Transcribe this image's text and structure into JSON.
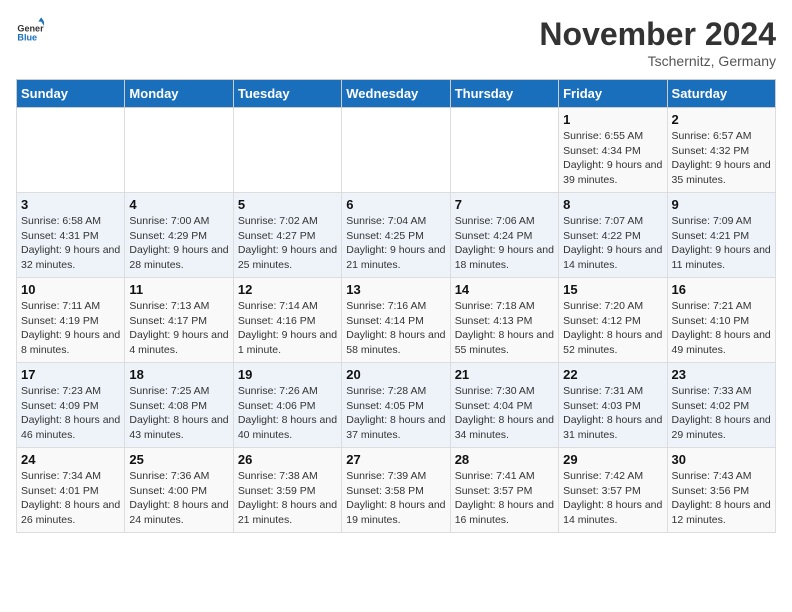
{
  "logo": {
    "general": "General",
    "blue": "Blue"
  },
  "header": {
    "month": "November 2024",
    "location": "Tschernitz, Germany"
  },
  "weekdays": [
    "Sunday",
    "Monday",
    "Tuesday",
    "Wednesday",
    "Thursday",
    "Friday",
    "Saturday"
  ],
  "weeks": [
    [
      {
        "day": "",
        "info": ""
      },
      {
        "day": "",
        "info": ""
      },
      {
        "day": "",
        "info": ""
      },
      {
        "day": "",
        "info": ""
      },
      {
        "day": "",
        "info": ""
      },
      {
        "day": "1",
        "info": "Sunrise: 6:55 AM\nSunset: 4:34 PM\nDaylight: 9 hours and 39 minutes."
      },
      {
        "day": "2",
        "info": "Sunrise: 6:57 AM\nSunset: 4:32 PM\nDaylight: 9 hours and 35 minutes."
      }
    ],
    [
      {
        "day": "3",
        "info": "Sunrise: 6:58 AM\nSunset: 4:31 PM\nDaylight: 9 hours and 32 minutes."
      },
      {
        "day": "4",
        "info": "Sunrise: 7:00 AM\nSunset: 4:29 PM\nDaylight: 9 hours and 28 minutes."
      },
      {
        "day": "5",
        "info": "Sunrise: 7:02 AM\nSunset: 4:27 PM\nDaylight: 9 hours and 25 minutes."
      },
      {
        "day": "6",
        "info": "Sunrise: 7:04 AM\nSunset: 4:25 PM\nDaylight: 9 hours and 21 minutes."
      },
      {
        "day": "7",
        "info": "Sunrise: 7:06 AM\nSunset: 4:24 PM\nDaylight: 9 hours and 18 minutes."
      },
      {
        "day": "8",
        "info": "Sunrise: 7:07 AM\nSunset: 4:22 PM\nDaylight: 9 hours and 14 minutes."
      },
      {
        "day": "9",
        "info": "Sunrise: 7:09 AM\nSunset: 4:21 PM\nDaylight: 9 hours and 11 minutes."
      }
    ],
    [
      {
        "day": "10",
        "info": "Sunrise: 7:11 AM\nSunset: 4:19 PM\nDaylight: 9 hours and 8 minutes."
      },
      {
        "day": "11",
        "info": "Sunrise: 7:13 AM\nSunset: 4:17 PM\nDaylight: 9 hours and 4 minutes."
      },
      {
        "day": "12",
        "info": "Sunrise: 7:14 AM\nSunset: 4:16 PM\nDaylight: 9 hours and 1 minute."
      },
      {
        "day": "13",
        "info": "Sunrise: 7:16 AM\nSunset: 4:14 PM\nDaylight: 8 hours and 58 minutes."
      },
      {
        "day": "14",
        "info": "Sunrise: 7:18 AM\nSunset: 4:13 PM\nDaylight: 8 hours and 55 minutes."
      },
      {
        "day": "15",
        "info": "Sunrise: 7:20 AM\nSunset: 4:12 PM\nDaylight: 8 hours and 52 minutes."
      },
      {
        "day": "16",
        "info": "Sunrise: 7:21 AM\nSunset: 4:10 PM\nDaylight: 8 hours and 49 minutes."
      }
    ],
    [
      {
        "day": "17",
        "info": "Sunrise: 7:23 AM\nSunset: 4:09 PM\nDaylight: 8 hours and 46 minutes."
      },
      {
        "day": "18",
        "info": "Sunrise: 7:25 AM\nSunset: 4:08 PM\nDaylight: 8 hours and 43 minutes."
      },
      {
        "day": "19",
        "info": "Sunrise: 7:26 AM\nSunset: 4:06 PM\nDaylight: 8 hours and 40 minutes."
      },
      {
        "day": "20",
        "info": "Sunrise: 7:28 AM\nSunset: 4:05 PM\nDaylight: 8 hours and 37 minutes."
      },
      {
        "day": "21",
        "info": "Sunrise: 7:30 AM\nSunset: 4:04 PM\nDaylight: 8 hours and 34 minutes."
      },
      {
        "day": "22",
        "info": "Sunrise: 7:31 AM\nSunset: 4:03 PM\nDaylight: 8 hours and 31 minutes."
      },
      {
        "day": "23",
        "info": "Sunrise: 7:33 AM\nSunset: 4:02 PM\nDaylight: 8 hours and 29 minutes."
      }
    ],
    [
      {
        "day": "24",
        "info": "Sunrise: 7:34 AM\nSunset: 4:01 PM\nDaylight: 8 hours and 26 minutes."
      },
      {
        "day": "25",
        "info": "Sunrise: 7:36 AM\nSunset: 4:00 PM\nDaylight: 8 hours and 24 minutes."
      },
      {
        "day": "26",
        "info": "Sunrise: 7:38 AM\nSunset: 3:59 PM\nDaylight: 8 hours and 21 minutes."
      },
      {
        "day": "27",
        "info": "Sunrise: 7:39 AM\nSunset: 3:58 PM\nDaylight: 8 hours and 19 minutes."
      },
      {
        "day": "28",
        "info": "Sunrise: 7:41 AM\nSunset: 3:57 PM\nDaylight: 8 hours and 16 minutes."
      },
      {
        "day": "29",
        "info": "Sunrise: 7:42 AM\nSunset: 3:57 PM\nDaylight: 8 hours and 14 minutes."
      },
      {
        "day": "30",
        "info": "Sunrise: 7:43 AM\nSunset: 3:56 PM\nDaylight: 8 hours and 12 minutes."
      }
    ]
  ]
}
